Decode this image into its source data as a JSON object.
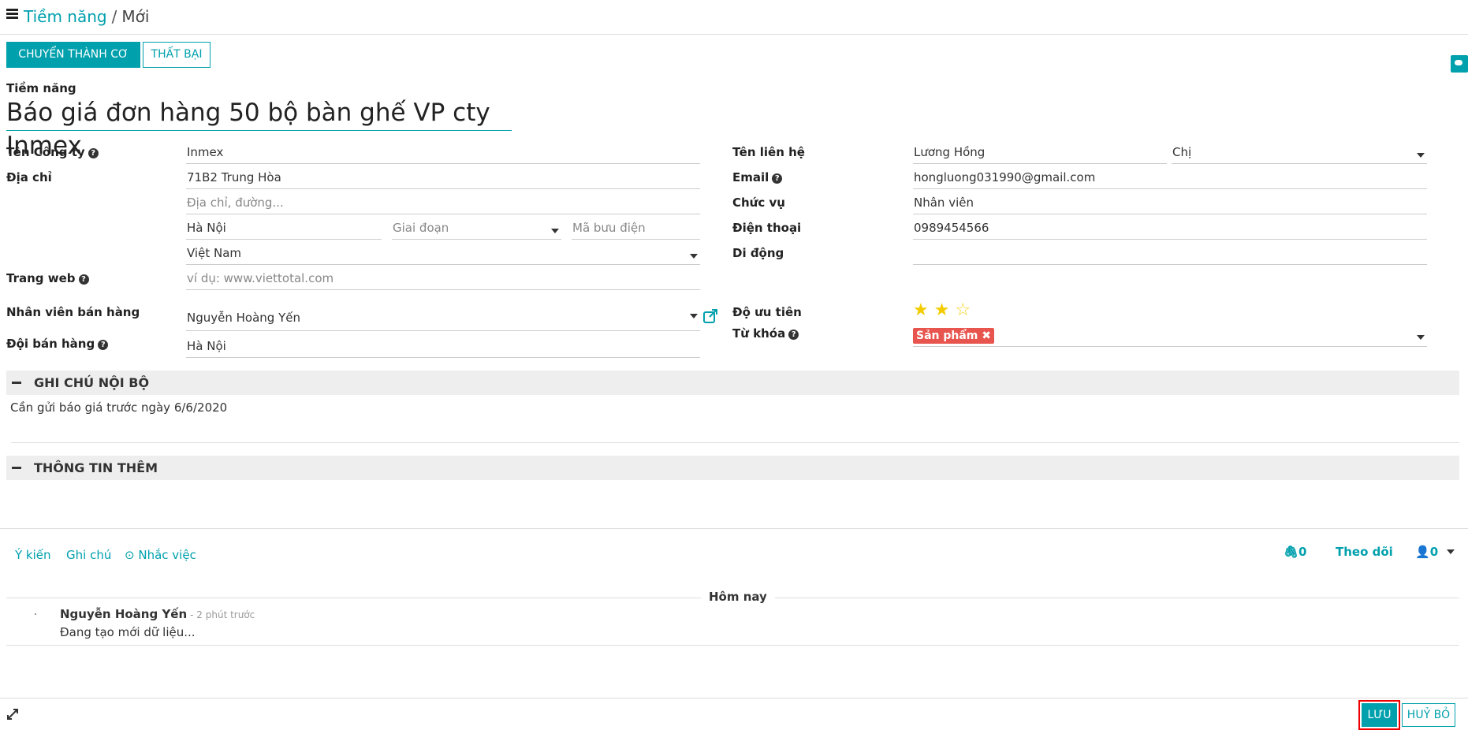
{
  "breadcrumb": {
    "parent": "Tiềm năng",
    "separator": "/",
    "current": "Mới"
  },
  "actions": {
    "convert": "CHUYỂN THÀNH CƠ HỘI",
    "lost": "THẤT BẠI"
  },
  "record": {
    "title_label": "Tiềm năng",
    "title": "Báo giá đơn hàng 50 bộ bàn ghế VP cty Inmex"
  },
  "left": {
    "company_label": "Tên Công ty",
    "company": "Inmex",
    "address_label": "Địa chỉ",
    "street": "71B2 Trung Hòa",
    "street2_placeholder": "Địa chỉ, đường...",
    "city": "Hà Nội",
    "state_placeholder": "Giai đoạn",
    "zip_placeholder": "Mã bưu điện",
    "country": "Việt Nam",
    "website_label": "Trang web",
    "website_placeholder": "ví dụ: www.viettotal.com",
    "salesperson_label": "Nhân viên bán hàng",
    "salesperson": "Nguyễn Hoàng Yến",
    "team_label": "Đội bán hàng",
    "team": "Hà Nội"
  },
  "right": {
    "contact_label": "Tên liên hệ",
    "contact": "Lương Hồng",
    "title": "Chị",
    "email_label": "Email",
    "email": "hongluong031990@gmail.com",
    "job_label": "Chức vụ",
    "job": "Nhân viên",
    "phone_label": "Điện thoại",
    "phone": "0989454566",
    "mobile_label": "Di động",
    "mobile": "",
    "priority_label": "Độ ưu tiên",
    "priority": 2,
    "priority_max": 3,
    "tags_label": "Từ khóa",
    "tag": "Sản phẩm"
  },
  "sections": {
    "internal_notes": "GHI CHÚ NỘI BỘ",
    "notes_text": "Cần gửi báo giá trước ngày 6/6/2020",
    "extra_info": "THÔNG TIN THÊM"
  },
  "chatter": {
    "send_message": "Ý kiến",
    "log_note": "Ghi chú",
    "schedule_activity": "Nhắc việc",
    "attachments": "0",
    "follow": "Theo dõi",
    "followers": "0",
    "today": "Hôm nay",
    "author": "Nguyễn Hoàng Yến",
    "time": "- 2 phút trước",
    "message": "Đang tạo mới dữ liệu..."
  },
  "footer": {
    "save": "LƯU",
    "discard": "HUỶ BỎ"
  },
  "colors": {
    "accent": "#00a0ad",
    "tag": "#e8554e",
    "star": "#f3cc00",
    "highlight": "#ee0000"
  }
}
